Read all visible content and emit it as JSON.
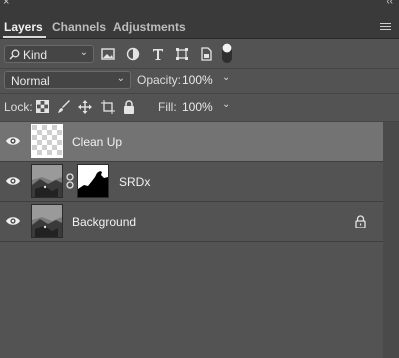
{
  "panel": {
    "close_glyph": "×",
    "collapse_glyph": "‹‹",
    "tabs": [
      {
        "label": "Layers",
        "active": true
      },
      {
        "label": "Channels",
        "active": false
      },
      {
        "label": "Adjustments",
        "active": false
      }
    ]
  },
  "filter": {
    "kind_label": "Kind",
    "filter_icons": [
      "image-filter-icon",
      "adjustment-filter-icon",
      "type-filter-icon",
      "shape-filter-icon",
      "smart-object-filter-icon",
      "filter-toggle-icon"
    ]
  },
  "blend": {
    "mode": "Normal",
    "opacity_label": "Opacity:",
    "opacity_value": "100%"
  },
  "lock": {
    "label": "Lock:",
    "icons": [
      "lock-transparency-icon",
      "lock-pixels-icon",
      "lock-position-icon",
      "lock-artboard-icon",
      "lock-all-icon"
    ],
    "fill_label": "Fill:",
    "fill_value": "100%"
  },
  "layers": [
    {
      "name": "Clean Up",
      "selected": true,
      "has_mask": false,
      "locked": false,
      "thumb": "transparent"
    },
    {
      "name": "SRDx",
      "selected": false,
      "has_mask": true,
      "locked": false,
      "thumb": "photo"
    },
    {
      "name": "Background",
      "selected": false,
      "has_mask": false,
      "locked": true,
      "thumb": "photo"
    }
  ],
  "colors": {
    "panel_bg": "#535353",
    "tab_bar_bg": "#3a3a3a",
    "selected_row": "#737373"
  }
}
